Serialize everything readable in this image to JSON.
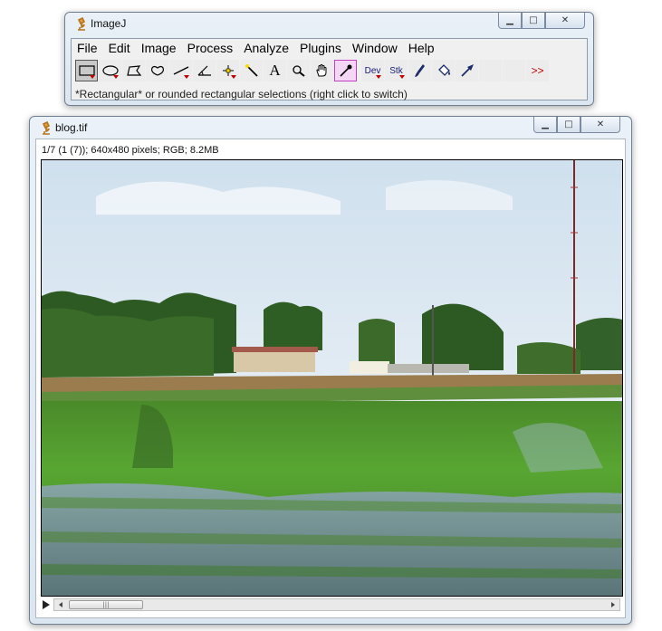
{
  "imagej_window": {
    "title": "ImageJ",
    "menu": [
      "File",
      "Edit",
      "Image",
      "Process",
      "Analyze",
      "Plugins",
      "Window",
      "Help"
    ],
    "tools": [
      {
        "name": "rectangle-tool",
        "label": ""
      },
      {
        "name": "oval-tool",
        "label": ""
      },
      {
        "name": "polygon-tool",
        "label": ""
      },
      {
        "name": "freehand-tool",
        "label": ""
      },
      {
        "name": "line-tool",
        "label": ""
      },
      {
        "name": "angle-tool",
        "label": ""
      },
      {
        "name": "point-tool",
        "label": ""
      },
      {
        "name": "wand-tool",
        "label": ""
      },
      {
        "name": "text-tool",
        "label": "A"
      },
      {
        "name": "magnifier-tool",
        "label": ""
      },
      {
        "name": "hand-tool",
        "label": ""
      },
      {
        "name": "color-picker-tool",
        "label": ""
      },
      {
        "name": "dev-tool",
        "label": "Dev"
      },
      {
        "name": "stk-tool",
        "label": "Stk"
      },
      {
        "name": "brush-tool",
        "label": ""
      },
      {
        "name": "flood-fill-tool",
        "label": ""
      },
      {
        "name": "arrow-tool",
        "label": ""
      },
      {
        "name": "more-tools",
        "label": ">>"
      }
    ],
    "status": "*Rectangular* or rounded rectangular selections (right click to switch)"
  },
  "image_window": {
    "title": "blog.tif",
    "info": "1/7 (1 (7)); 640x480 pixels; RGB; 8.2MB"
  },
  "colors": {
    "titlebar": "#dbe6f1",
    "accent_red": "#c00000",
    "picker": "#c23fc2"
  }
}
